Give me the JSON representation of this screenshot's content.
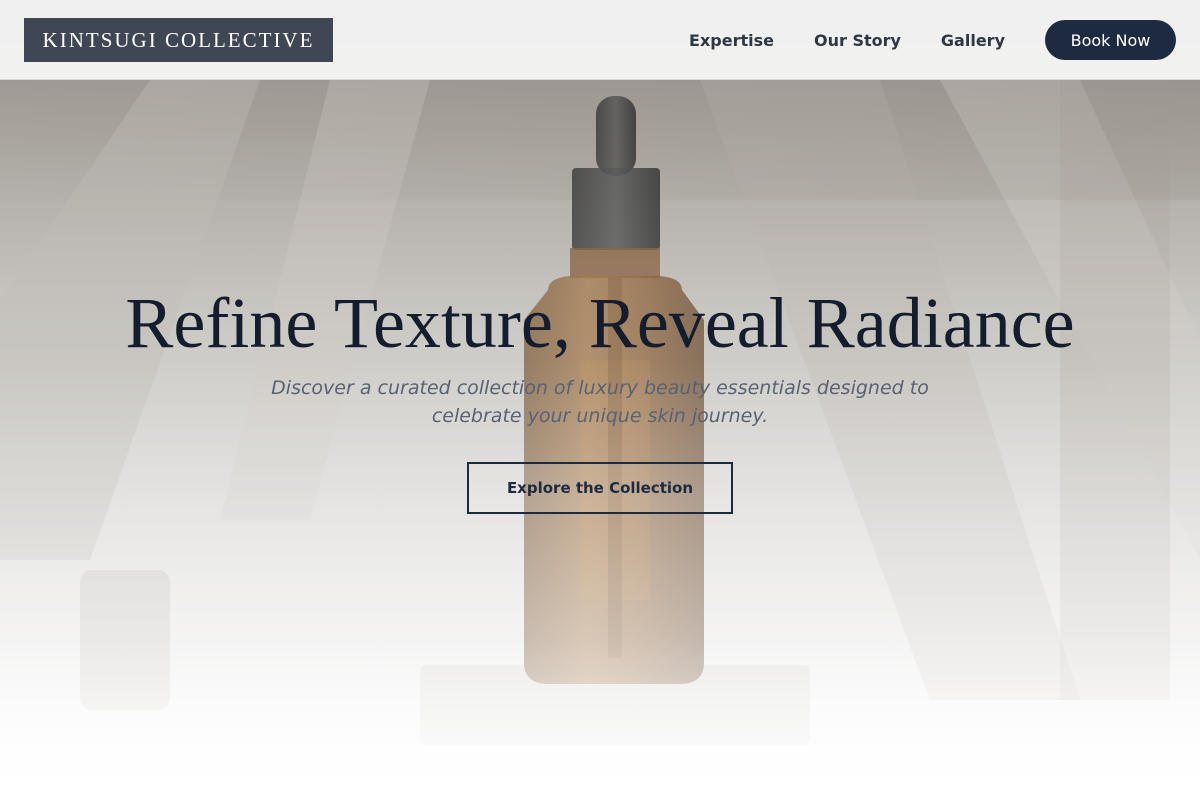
{
  "header": {
    "logo_text": "KINTSUGI COLLECTIVE",
    "nav_links": [
      "Expertise",
      "Our Story",
      "Gallery"
    ],
    "cta_label": "Book Now"
  },
  "hero": {
    "title": "Refine Texture, Reveal Radiance",
    "subtitle_line1": "Discover a curated collection of luxury beauty essentials designed to",
    "subtitle_line2": "celebrate your unique skin journey.",
    "button_label": "Explore the Collection",
    "background_image": "amber-dropper-bottle-photo"
  },
  "colors": {
    "brand_navy": "#1d2a40",
    "logo_bg": "#3f4654",
    "text_dark": "#141c2e",
    "subtitle": "#596273",
    "nav_bg": "#f6f6f6"
  }
}
